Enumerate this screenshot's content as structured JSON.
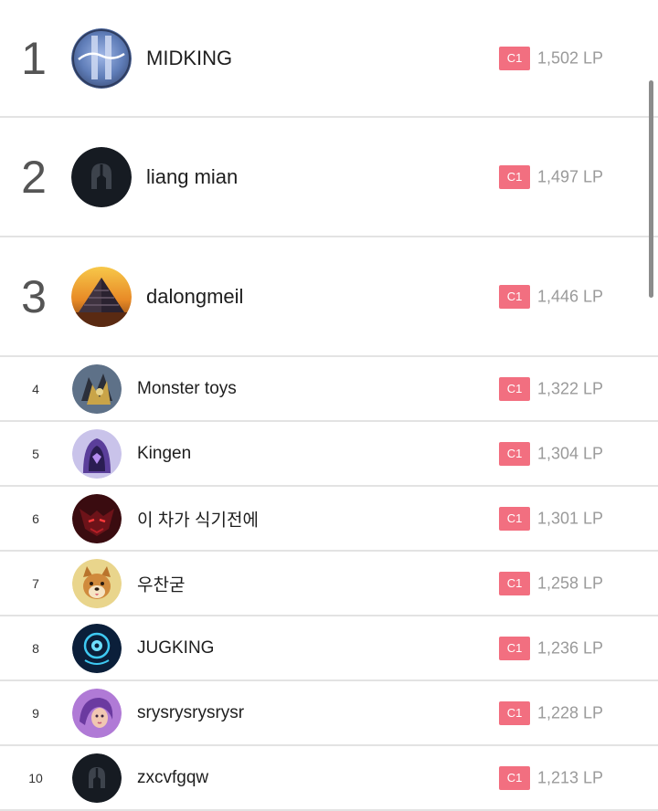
{
  "leaderboard": {
    "rows": [
      {
        "rank": "1",
        "name": "MIDKING",
        "tier": "C1",
        "lp": "1,502 LP",
        "avatar": "shieldmaker-icon"
      },
      {
        "rank": "2",
        "name": "liang mian",
        "tier": "C1",
        "lp": "1,497 LP",
        "avatar": "helmet-icon"
      },
      {
        "rank": "3",
        "name": "dalongmeil",
        "tier": "C1",
        "lp": "1,446 LP",
        "avatar": "pyramid-icon"
      },
      {
        "rank": "4",
        "name": "Monster toys",
        "tier": "C1",
        "lp": "1,322 LP",
        "avatar": "monster-icon"
      },
      {
        "rank": "5",
        "name": "Kingen",
        "tier": "C1",
        "lp": "1,304 LP",
        "avatar": "hooded-figure-icon"
      },
      {
        "rank": "6",
        "name": "이 차가 식기전에",
        "tier": "C1",
        "lp": "1,301 LP",
        "avatar": "demon-icon"
      },
      {
        "rank": "7",
        "name": "우찬굳",
        "tier": "C1",
        "lp": "1,258 LP",
        "avatar": "dog-icon"
      },
      {
        "rank": "8",
        "name": "JUGKING",
        "tier": "C1",
        "lp": "1,236 LP",
        "avatar": "cyber-eye-icon"
      },
      {
        "rank": "9",
        "name": "srysrysrysrysr",
        "tier": "C1",
        "lp": "1,228 LP",
        "avatar": "purple-hair-icon"
      },
      {
        "rank": "10",
        "name": "zxcvfgqw",
        "tier": "C1",
        "lp": "1,213 LP",
        "avatar": "helmet-icon"
      }
    ]
  },
  "colors": {
    "tier_badge": "#f26f80",
    "lp_text": "#9a9a9a",
    "divider": "#e3e3e3"
  }
}
